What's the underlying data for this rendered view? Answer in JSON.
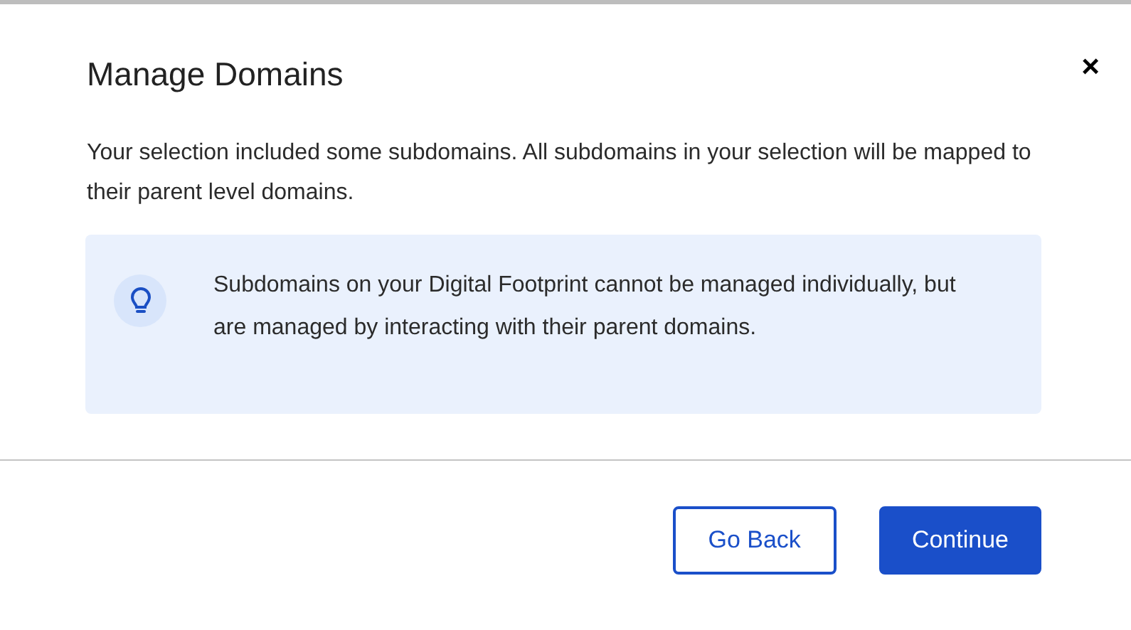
{
  "dialog": {
    "title": "Manage Domains",
    "close": "×",
    "message": "Your selection included some subdomains. All subdomains in your selection will be mapped to their parent level domains.",
    "callout": {
      "text": "Subdomains on your Digital Footprint cannot be managed individually, but are managed by interacting with their parent domains."
    },
    "buttons": [
      {
        "label": "Go Back",
        "kind": "secondary"
      },
      {
        "label": "Continue",
        "kind": "primary"
      }
    ]
  }
}
